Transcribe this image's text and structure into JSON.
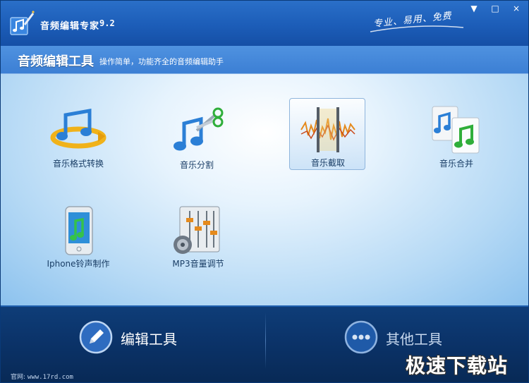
{
  "app": {
    "title": "音频编辑专家",
    "version": "9.2",
    "slogan": "专业、易用、免费"
  },
  "window_controls": {
    "minimize": "▼",
    "maximize": "□",
    "close": "×"
  },
  "header": {
    "section_title": "音频编辑工具",
    "section_desc": "操作简单，功能齐全的音频编辑助手"
  },
  "tools": [
    {
      "label": "音乐格式转换",
      "icon": "music-format-convert-icon",
      "selected": false
    },
    {
      "label": "音乐分割",
      "icon": "music-split-icon",
      "selected": false
    },
    {
      "label": "音乐截取",
      "icon": "music-cut-icon",
      "selected": true
    },
    {
      "label": "音乐合并",
      "icon": "music-merge-icon",
      "selected": false
    },
    {
      "label": "Iphone铃声制作",
      "icon": "iphone-ringtone-icon",
      "selected": false
    },
    {
      "label": "MP3音量调节",
      "icon": "mp3-volume-icon",
      "selected": false
    }
  ],
  "bottom_tabs": {
    "edit_tools": "编辑工具",
    "other_tools": "其他工具"
  },
  "footer": {
    "website_label": "官网:",
    "website_url": "www.17rd.com",
    "watermark": "极速下载站"
  },
  "colors": {
    "titlebar": "#1c5db8",
    "subbar": "#3c7fd4",
    "bottombar": "#0b3369",
    "tool_label": "#1a3e66"
  }
}
